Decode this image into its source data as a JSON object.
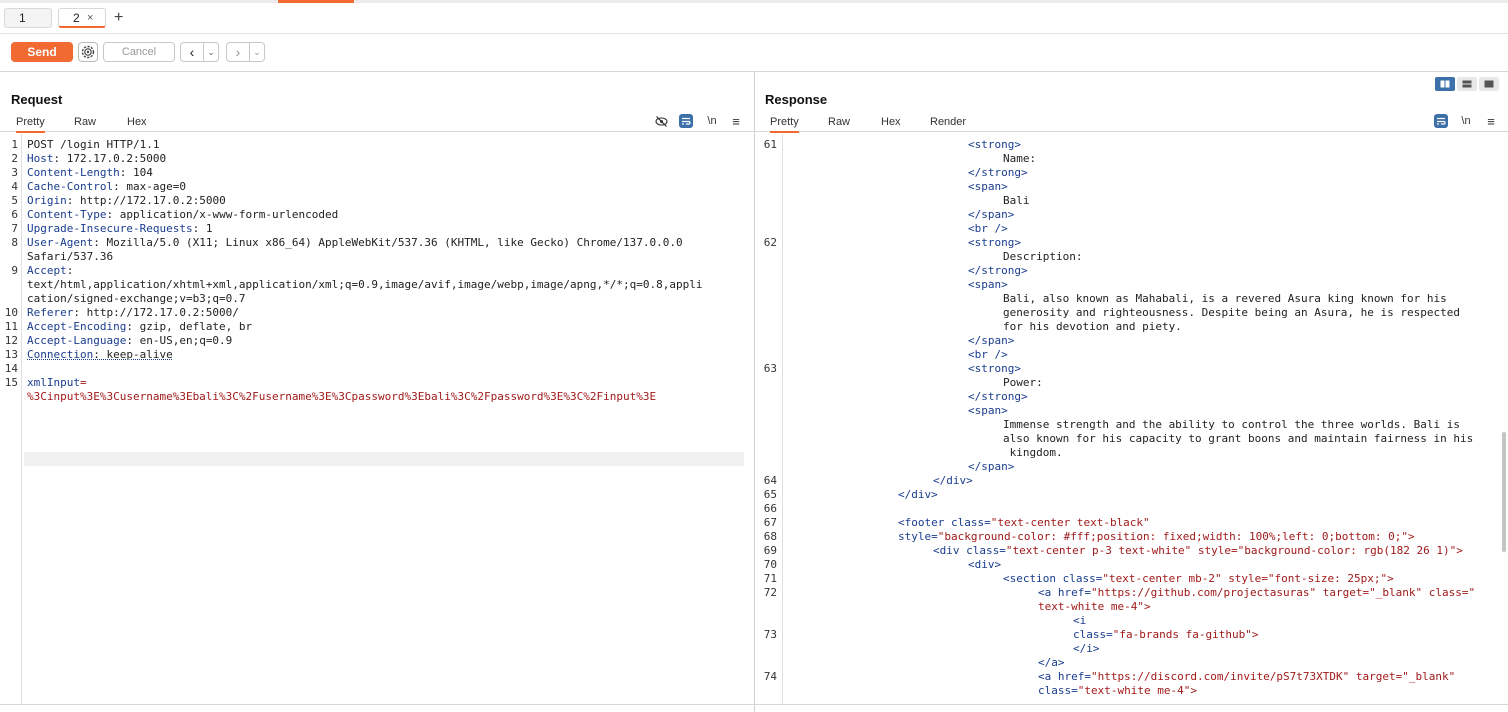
{
  "tabs": [
    {
      "label": "1"
    },
    {
      "label": "2",
      "close": "×"
    }
  ],
  "tab_add": "+",
  "toolbar": {
    "send_label": "Send",
    "cancel_label": "Cancel",
    "back_arrow": "‹",
    "fwd_arrow": "›",
    "dropdown": "⌄"
  },
  "request": {
    "title": "Request",
    "subtabs": [
      "Pretty",
      "Raw",
      "Hex"
    ],
    "ctrl_newline": "\\n",
    "ctrl_menu": "≡",
    "lines": [
      {
        "n": "1",
        "k": "",
        "v": "POST /login HTTP/1.1"
      },
      {
        "n": "2",
        "k": "Host",
        "v": ": 172.17.0.2:5000"
      },
      {
        "n": "3",
        "k": "Content-Length",
        "v": ": 104"
      },
      {
        "n": "4",
        "k": "Cache-Control",
        "v": ": max-age=0"
      },
      {
        "n": "5",
        "k": "Origin",
        "v": ": http://172.17.0.2:5000"
      },
      {
        "n": "6",
        "k": "Content-Type",
        "v": ": application/x-www-form-urlencoded"
      },
      {
        "n": "7",
        "k": "Upgrade-Insecure-Requests",
        "v": ": 1"
      },
      {
        "n": "8",
        "k": "User-Agent",
        "v": ": Mozilla/5.0 (X11; Linux x86_64) AppleWebKit/537.36 (KHTML, like Gecko) Chrome/137.0.0.0"
      },
      {
        "n": "",
        "k": "",
        "v": "Safari/537.36"
      },
      {
        "n": "9",
        "k": "Accept",
        "v": ":"
      },
      {
        "n": "",
        "k": "",
        "v": "text/html,application/xhtml+xml,application/xml;q=0.9,image/avif,image/webp,image/apng,*/*;q=0.8,appli"
      },
      {
        "n": "",
        "k": "",
        "v": "cation/signed-exchange;v=b3;q=0.7"
      },
      {
        "n": "10",
        "k": "Referer",
        "v": ": http://172.17.0.2:5000/"
      },
      {
        "n": "11",
        "k": "Accept-Encoding",
        "v": ": gzip, deflate, br"
      },
      {
        "n": "12",
        "k": "Accept-Language",
        "v": ": en-US,en;q=0.9"
      },
      {
        "n": "13",
        "k": "Connection",
        "v": ": keep-alive"
      },
      {
        "n": "14",
        "k": "",
        "v": ""
      },
      {
        "n": "15",
        "k": "xmlInput",
        "v": "="
      },
      {
        "n": "",
        "k": "",
        "v": "%3Cinput%3E%3Cusername%3Ebali%3C%2Fusername%3E%3Cpassword%3Ebali%3C%2Fpassword%3E%3C%2Finput%3E",
        "body": true
      }
    ]
  },
  "response": {
    "title": "Response",
    "subtabs": [
      "Pretty",
      "Raw",
      "Hex",
      "Render"
    ],
    "ctrl_newline": "\\n",
    "ctrl_menu": "≡",
    "lines": [
      {
        "n": "61",
        "i": 180,
        "t": "<strong>",
        "tag": true
      },
      {
        "n": "",
        "i": 215,
        "t": "Name:"
      },
      {
        "n": "",
        "i": 180,
        "t": "</strong>",
        "tag": true
      },
      {
        "n": "",
        "i": 180,
        "t": "<span>",
        "tag": true
      },
      {
        "n": "",
        "i": 215,
        "t": "Bali"
      },
      {
        "n": "",
        "i": 180,
        "t": "</span>",
        "tag": true
      },
      {
        "n": "",
        "i": 180,
        "t": "<br />",
        "tag": true
      },
      {
        "n": "62",
        "i": 180,
        "t": "<strong>",
        "tag": true
      },
      {
        "n": "",
        "i": 215,
        "t": "Description:"
      },
      {
        "n": "",
        "i": 180,
        "t": "</strong>",
        "tag": true
      },
      {
        "n": "",
        "i": 180,
        "t": "<span>",
        "tag": true
      },
      {
        "n": "",
        "i": 215,
        "t": "Bali, also known as Mahabali, is a revered Asura king known for his"
      },
      {
        "n": "",
        "i": 215,
        "t": "generosity and righteousness. Despite being an Asura, he is respected"
      },
      {
        "n": "",
        "i": 215,
        "t": "for his devotion and piety."
      },
      {
        "n": "",
        "i": 180,
        "t": "</span>",
        "tag": true
      },
      {
        "n": "",
        "i": 180,
        "t": "<br />",
        "tag": true
      },
      {
        "n": "63",
        "i": 180,
        "t": "<strong>",
        "tag": true
      },
      {
        "n": "",
        "i": 215,
        "t": "Power:"
      },
      {
        "n": "",
        "i": 180,
        "t": "</strong>",
        "tag": true
      },
      {
        "n": "",
        "i": 180,
        "t": "<span>",
        "tag": true
      },
      {
        "n": "",
        "i": 215,
        "t": "Immense strength and the ability to control the three worlds. Bali is"
      },
      {
        "n": "",
        "i": 215,
        "t": "also known for his capacity to grant boons and maintain fairness in his"
      },
      {
        "n": "",
        "i": 215,
        "t": " kingdom."
      },
      {
        "n": "",
        "i": 180,
        "t": "</span>",
        "tag": true
      },
      {
        "n": "64",
        "i": 145,
        "t": "</div>",
        "tag": true
      },
      {
        "n": "65",
        "i": 110,
        "t": "</div>",
        "tag": true
      },
      {
        "n": "66",
        "i": 0,
        "t": ""
      },
      {
        "n": "67",
        "i": 110,
        "t": "<footer ",
        "tag": true,
        "a": "class=",
        "av": "\"text-center text-black\""
      },
      {
        "n": "68",
        "i": 110,
        "t": "",
        "a": "style=",
        "av": "\"background-color: #fff;position: fixed;width: 100%;left: 0;bottom: 0;\">"
      },
      {
        "n": "69",
        "i": 145,
        "t": "<div ",
        "tag": true,
        "a": "class=",
        "av": "\"text-center p-3 text-white\" style=\"background-color: rgb(182 26 1)\">"
      },
      {
        "n": "70",
        "i": 180,
        "t": "<div>",
        "tag": true
      },
      {
        "n": "71",
        "i": 215,
        "t": "<section ",
        "tag": true,
        "a": "class=",
        "av": "\"text-center mb-2\" style=\"font-size: 25px;\">"
      },
      {
        "n": "72",
        "i": 250,
        "t": "<a ",
        "tag": true,
        "a": "href=",
        "av": "\"https://github.com/projectasuras\" target=\"_blank\" class=\""
      },
      {
        "n": "",
        "i": 250,
        "t": "",
        "a": "",
        "av": "text-white me-4\">"
      },
      {
        "n": "",
        "i": 285,
        "t": "<i",
        "tag": true
      },
      {
        "n": "73",
        "i": 285,
        "t": "",
        "a": "class=",
        "av": "\"fa-brands fa-github\">"
      },
      {
        "n": "",
        "i": 285,
        "t": "</i>",
        "tag": true
      },
      {
        "n": "",
        "i": 250,
        "t": "</a>",
        "tag": true
      },
      {
        "n": "74",
        "i": 250,
        "t": "<a ",
        "tag": true,
        "a": "href=",
        "av": "\"https://discord.com/invite/pS7t73XTDK\" target=\"_blank\""
      },
      {
        "n": "",
        "i": 250,
        "t": "",
        "a": "class=",
        "av": "\"text-white me-4\">"
      }
    ]
  }
}
